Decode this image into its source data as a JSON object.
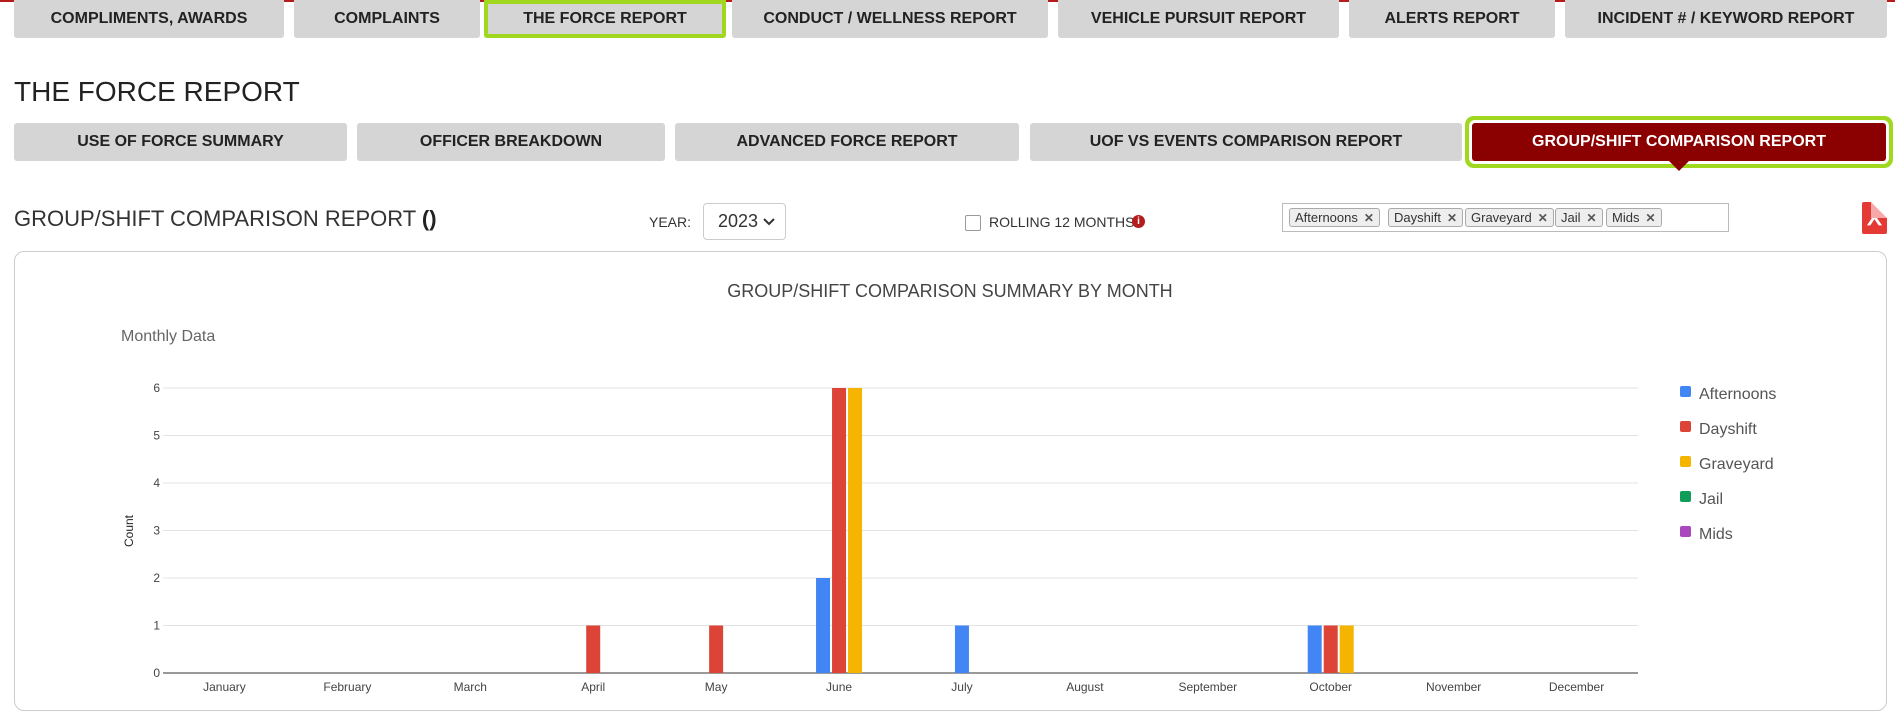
{
  "nav": {
    "items": [
      {
        "label": "COMPLIMENTS, AWARDS"
      },
      {
        "label": "COMPLAINTS"
      },
      {
        "label": "THE FORCE REPORT"
      },
      {
        "label": "CONDUCT / WELLNESS REPORT"
      },
      {
        "label": "VEHICLE PURSUIT REPORT"
      },
      {
        "label": "ALERTS REPORT"
      },
      {
        "label": "INCIDENT # / KEYWORD REPORT"
      }
    ],
    "selected": "THE FORCE REPORT"
  },
  "page_title": "THE FORCE REPORT",
  "subnav": {
    "items": [
      {
        "label": "USE OF FORCE SUMMARY"
      },
      {
        "label": "OFFICER BREAKDOWN"
      },
      {
        "label": "ADVANCED FORCE REPORT"
      },
      {
        "label": "UOF VS EVENTS COMPARISON REPORT"
      },
      {
        "label": "GROUP/SHIFT COMPARISON REPORT"
      }
    ],
    "active": "GROUP/SHIFT COMPARISON REPORT"
  },
  "report": {
    "title": "GROUP/SHIFT COMPARISON REPORT",
    "title_suffix": "()",
    "year_label": "YEAR:",
    "year_value": "2023",
    "rolling_label": "ROLLING 12 MONTHS",
    "rolling_checked": false,
    "info_icon": "info-icon",
    "pdf_icon": "pdf-icon",
    "selected_groups": [
      "Afternoons",
      "Dayshift",
      "Graveyard",
      "Jail",
      "Mids"
    ]
  },
  "chart_data": {
    "type": "bar",
    "title": "GROUP/SHIFT COMPARISON SUMMARY BY MONTH",
    "subtitle": "Monthly Data",
    "xlabel": "",
    "ylabel": "Count",
    "ylim": [
      0,
      6
    ],
    "yticks": [
      0,
      1,
      2,
      3,
      4,
      5,
      6
    ],
    "grid": true,
    "legend_position": "right",
    "categories": [
      "January",
      "February",
      "March",
      "April",
      "May",
      "June",
      "July",
      "August",
      "September",
      "October",
      "November",
      "December"
    ],
    "series": [
      {
        "name": "Afternoons",
        "color": "#4285f4",
        "values": [
          0,
          0,
          0,
          0,
          0,
          2,
          1,
          0,
          0,
          1,
          0,
          0
        ]
      },
      {
        "name": "Dayshift",
        "color": "#db4437",
        "values": [
          0,
          0,
          0,
          1,
          1,
          6,
          0,
          0,
          0,
          1,
          0,
          0
        ]
      },
      {
        "name": "Graveyard",
        "color": "#f4b400",
        "values": [
          0,
          0,
          0,
          0,
          0,
          6,
          0,
          0,
          0,
          1,
          0,
          0
        ]
      },
      {
        "name": "Jail",
        "color": "#0f9d58",
        "values": [
          0,
          0,
          0,
          0,
          0,
          0,
          0,
          0,
          0,
          0,
          0,
          0
        ]
      },
      {
        "name": "Mids",
        "color": "#ab47bc",
        "values": [
          0,
          0,
          0,
          0,
          0,
          0,
          0,
          0,
          0,
          0,
          0,
          0
        ]
      }
    ]
  }
}
